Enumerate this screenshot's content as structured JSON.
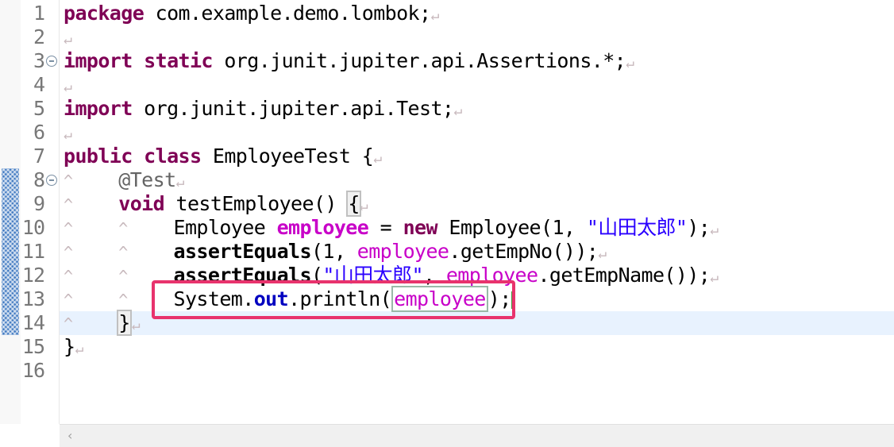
{
  "editor": {
    "line_numbers": [
      "1",
      "2",
      "3",
      "4",
      "5",
      "6",
      "7",
      "8",
      "9",
      "10",
      "11",
      "12",
      "13",
      "14",
      "15",
      "16"
    ],
    "lines": {
      "l1": {
        "kw": "package",
        "rest": " com.example.demo.lombok;",
        "eol": "↵"
      },
      "l2": {
        "eol": "↵"
      },
      "l3": {
        "kw1": "import",
        "kw2": "static",
        "rest": " org.junit.jupiter.api.Assertions.*;",
        "eol": "↵"
      },
      "l4": {
        "eol": "↵"
      },
      "l5": {
        "kw": "import",
        "rest": " org.junit.jupiter.api.Test;",
        "eol": "↵"
      },
      "l6": {
        "eol": "↵"
      },
      "l7": {
        "kw1": "public",
        "kw2": "class",
        "rest": " EmployeeTest {",
        "eol": "↵"
      },
      "l8": {
        "tab": "^",
        "annotation": "@Test",
        "eol": "↵"
      },
      "l9": {
        "tab": "^",
        "kw": "void",
        "rest": " testEmployee() ",
        "brace": "{",
        "eol": "↵"
      },
      "l10": {
        "tab1": "^",
        "tab2": "^",
        "type": "Employee ",
        "var": "employee",
        "eq": " = ",
        "kw": "new",
        "call": " Employee(1, ",
        "str": "\"山田太郎\"",
        "end": ");",
        "eol": "↵"
      },
      "l11": {
        "tab1": "^",
        "tab2": "^",
        "method": "assertEquals",
        "args1": "(1, ",
        "var": "employee",
        "args2": ".getEmpNo());",
        "eol": "↵"
      },
      "l12": {
        "tab1": "^",
        "tab2": "^",
        "method": "assertEquals",
        "args1": "(",
        "str": "\"山田太郎\"",
        "comma": ", ",
        "var": "employee",
        "args2": ".getEmpName());",
        "eol": "↵"
      },
      "l13": {
        "tab1": "^",
        "tab2": "^",
        "cls": "System.",
        "field": "out",
        "call": ".println(",
        "var": "employee",
        "end": ");",
        "eol": "↵"
      },
      "l14": {
        "tab": "^",
        "brace": "}",
        "eol": "↵"
      },
      "l15": {
        "brace": "}",
        "eol": "↵"
      },
      "l16": {}
    }
  },
  "scrollbar": {
    "left_arrow": "‹"
  },
  "colors": {
    "keyword": "#7f0055",
    "field": "#c800c8",
    "string": "#2a00ff",
    "highlight_box": "#e8336d"
  }
}
